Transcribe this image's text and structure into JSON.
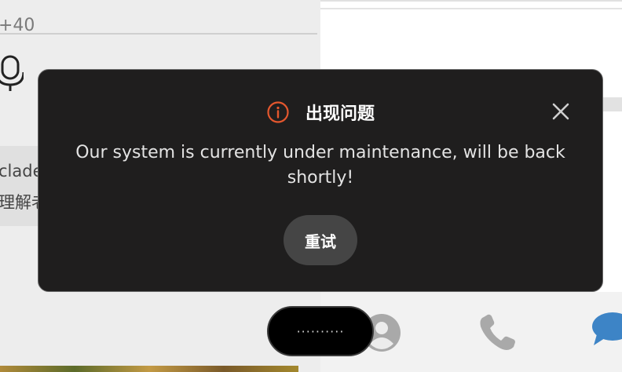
{
  "background": {
    "top_value": "+40",
    "message_line1": "clade",
    "message_line2": "理解老"
  },
  "pill": {
    "label": "··········"
  },
  "dialog": {
    "title": "出现问题",
    "message": "Our system is currently under maintenance, will be back shortly!",
    "retry_label": "重试",
    "icons": {
      "info": "info-icon",
      "close": "close-icon"
    },
    "colors": {
      "accent": "#e4572e",
      "background": "#1f1e1e"
    }
  },
  "nav_icons": [
    "contact-icon",
    "phone-icon",
    "chat-icon"
  ]
}
